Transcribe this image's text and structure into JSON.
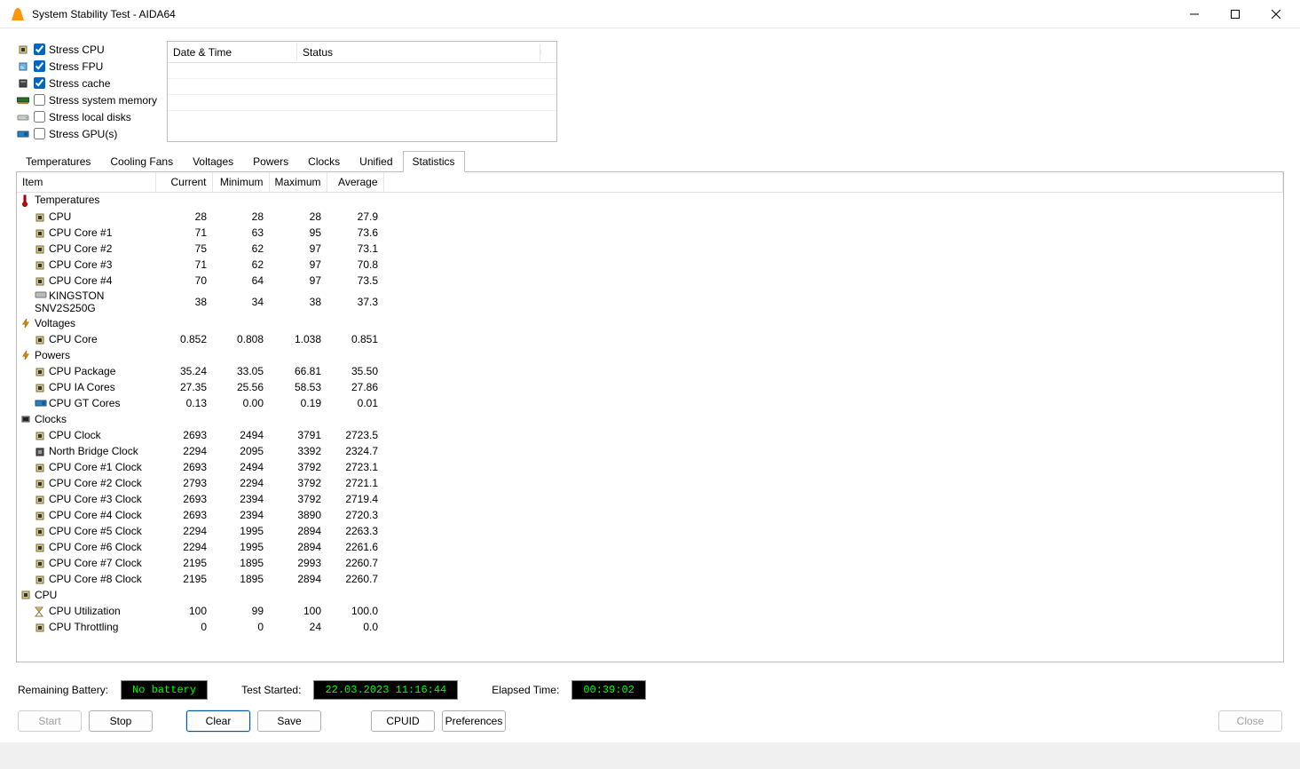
{
  "window": {
    "title": "System Stability Test - AIDA64"
  },
  "stress_options": [
    {
      "label": "Stress CPU",
      "checked": true,
      "icon": "cpu-chip"
    },
    {
      "label": "Stress FPU",
      "checked": true,
      "icon": "fpu-chip"
    },
    {
      "label": "Stress cache",
      "checked": true,
      "icon": "cache-chip"
    },
    {
      "label": "Stress system memory",
      "checked": false,
      "icon": "ram-stick"
    },
    {
      "label": "Stress local disks",
      "checked": false,
      "icon": "disk"
    },
    {
      "label": "Stress GPU(s)",
      "checked": false,
      "icon": "gpu-chip"
    }
  ],
  "status_grid": {
    "col_date": "Date & Time",
    "col_status": "Status"
  },
  "tabs": [
    "Temperatures",
    "Cooling Fans",
    "Voltages",
    "Powers",
    "Clocks",
    "Unified",
    "Statistics"
  ],
  "active_tab": "Statistics",
  "stats_headers": {
    "item": "Item",
    "current": "Current",
    "minimum": "Minimum",
    "maximum": "Maximum",
    "average": "Average"
  },
  "stats": [
    {
      "type": "cat",
      "icon": "therm",
      "label": "Temperatures"
    },
    {
      "type": "row",
      "icon": "chip",
      "label": "CPU",
      "cur": "28",
      "min": "28",
      "max": "28",
      "avg": "27.9"
    },
    {
      "type": "row",
      "icon": "chip",
      "label": "CPU Core #1",
      "cur": "71",
      "min": "63",
      "max": "95",
      "avg": "73.6"
    },
    {
      "type": "row",
      "icon": "chip",
      "label": "CPU Core #2",
      "cur": "75",
      "min": "62",
      "max": "97",
      "avg": "73.1"
    },
    {
      "type": "row",
      "icon": "chip",
      "label": "CPU Core #3",
      "cur": "71",
      "min": "62",
      "max": "97",
      "avg": "70.8"
    },
    {
      "type": "row",
      "icon": "chip",
      "label": "CPU Core #4",
      "cur": "70",
      "min": "64",
      "max": "97",
      "avg": "73.5"
    },
    {
      "type": "row",
      "icon": "ssd",
      "label": "KINGSTON SNV2S250G",
      "cur": "38",
      "min": "34",
      "max": "38",
      "avg": "37.3"
    },
    {
      "type": "cat",
      "icon": "volt",
      "label": "Voltages"
    },
    {
      "type": "row",
      "icon": "chip",
      "label": "CPU Core",
      "cur": "0.852",
      "min": "0.808",
      "max": "1.038",
      "avg": "0.851"
    },
    {
      "type": "cat",
      "icon": "volt",
      "label": "Powers"
    },
    {
      "type": "row",
      "icon": "chip",
      "label": "CPU Package",
      "cur": "35.24",
      "min": "33.05",
      "max": "66.81",
      "avg": "35.50"
    },
    {
      "type": "row",
      "icon": "chip",
      "label": "CPU IA Cores",
      "cur": "27.35",
      "min": "25.56",
      "max": "58.53",
      "avg": "27.86"
    },
    {
      "type": "row",
      "icon": "gpu",
      "label": "CPU GT Cores",
      "cur": "0.13",
      "min": "0.00",
      "max": "0.19",
      "avg": "0.01"
    },
    {
      "type": "cat",
      "icon": "clock",
      "label": "Clocks"
    },
    {
      "type": "row",
      "icon": "chip",
      "label": "CPU Clock",
      "cur": "2693",
      "min": "2494",
      "max": "3791",
      "avg": "2723.5"
    },
    {
      "type": "row",
      "icon": "nb",
      "label": "North Bridge Clock",
      "cur": "2294",
      "min": "2095",
      "max": "3392",
      "avg": "2324.7"
    },
    {
      "type": "row",
      "icon": "chip",
      "label": "CPU Core #1 Clock",
      "cur": "2693",
      "min": "2494",
      "max": "3792",
      "avg": "2723.1"
    },
    {
      "type": "row",
      "icon": "chip",
      "label": "CPU Core #2 Clock",
      "cur": "2793",
      "min": "2294",
      "max": "3792",
      "avg": "2721.1"
    },
    {
      "type": "row",
      "icon": "chip",
      "label": "CPU Core #3 Clock",
      "cur": "2693",
      "min": "2394",
      "max": "3792",
      "avg": "2719.4"
    },
    {
      "type": "row",
      "icon": "chip",
      "label": "CPU Core #4 Clock",
      "cur": "2693",
      "min": "2394",
      "max": "3890",
      "avg": "2720.3"
    },
    {
      "type": "row",
      "icon": "chip",
      "label": "CPU Core #5 Clock",
      "cur": "2294",
      "min": "1995",
      "max": "2894",
      "avg": "2263.3"
    },
    {
      "type": "row",
      "icon": "chip",
      "label": "CPU Core #6 Clock",
      "cur": "2294",
      "min": "1995",
      "max": "2894",
      "avg": "2261.6"
    },
    {
      "type": "row",
      "icon": "chip",
      "label": "CPU Core #7 Clock",
      "cur": "2195",
      "min": "1895",
      "max": "2993",
      "avg": "2260.7"
    },
    {
      "type": "row",
      "icon": "chip",
      "label": "CPU Core #8 Clock",
      "cur": "2195",
      "min": "1895",
      "max": "2894",
      "avg": "2260.7"
    },
    {
      "type": "cat",
      "icon": "chip",
      "label": "CPU"
    },
    {
      "type": "row",
      "icon": "hourglass",
      "label": "CPU Utilization",
      "cur": "100",
      "min": "99",
      "max": "100",
      "avg": "100.0"
    },
    {
      "type": "row",
      "icon": "chip",
      "label": "CPU Throttling",
      "cur": "0",
      "min": "0",
      "max": "24",
      "avg": "0.0"
    }
  ],
  "status_bar": {
    "battery_label": "Remaining Battery:",
    "battery_value": "No battery",
    "started_label": "Test Started:",
    "started_value": "22.03.2023 11:16:44",
    "elapsed_label": "Elapsed Time:",
    "elapsed_value": "00:39:02"
  },
  "buttons": {
    "start": "Start",
    "stop": "Stop",
    "clear": "Clear",
    "save": "Save",
    "cpuid": "CPUID",
    "preferences": "Preferences",
    "close": "Close"
  }
}
